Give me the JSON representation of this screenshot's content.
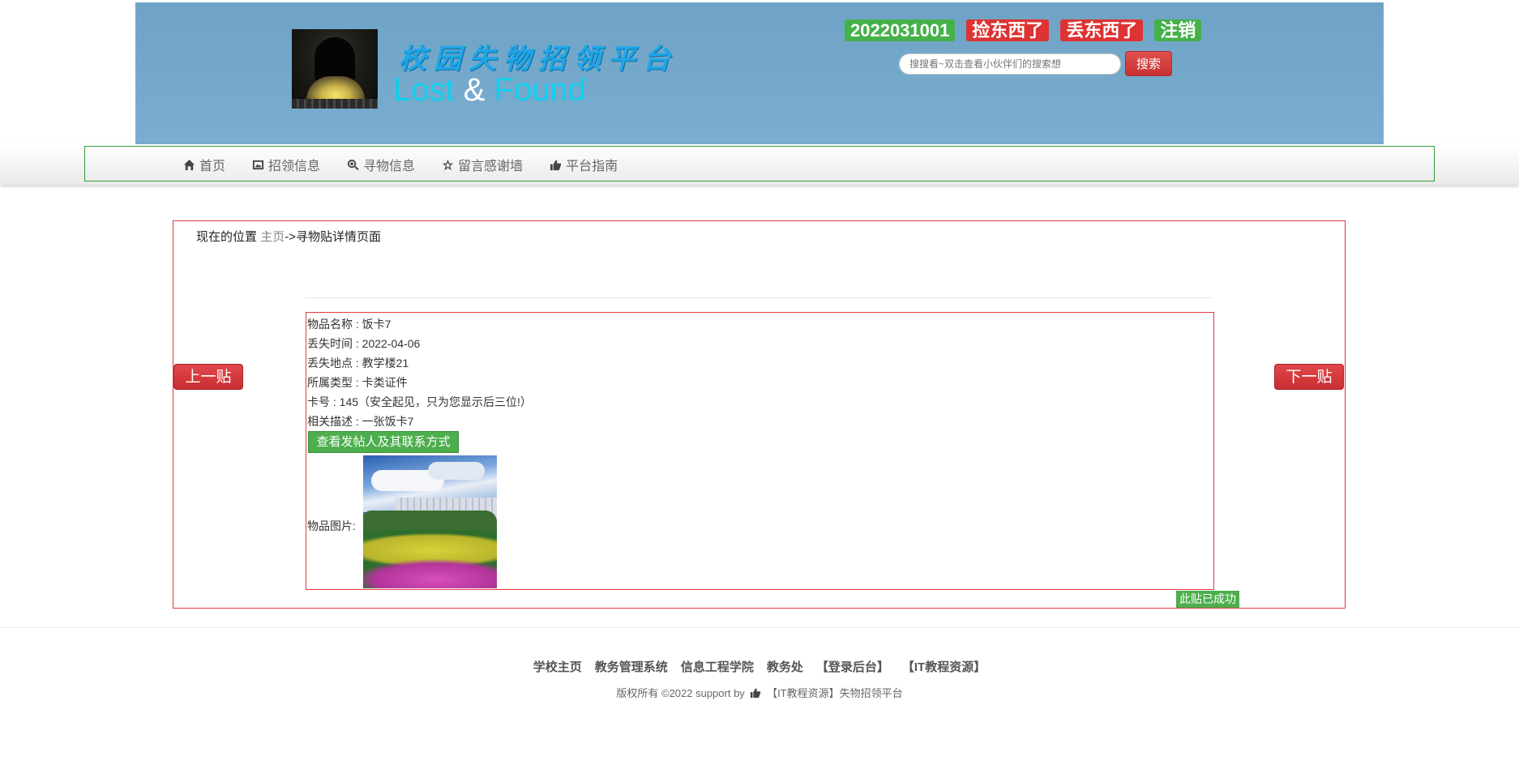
{
  "header": {
    "title_cn": "校园失物招领平台",
    "title_en_lost": "Lost",
    "title_en_amp": "&",
    "title_en_found": "Found",
    "user_id": "2022031001",
    "found_label": "捡东西了",
    "lost_label": "丢东西了",
    "logout_label": "注销",
    "search_placeholder": "搜搜看~双击查看小伙伴们的搜索想",
    "search_button": "搜索",
    "colors": {
      "header_bg": "#74a9cc",
      "green": "#45b149",
      "red": "#dd3333"
    }
  },
  "nav": {
    "items": [
      {
        "label": "首页",
        "icon": "home-icon"
      },
      {
        "label": "招领信息",
        "icon": "picture-icon"
      },
      {
        "label": "寻物信息",
        "icon": "zoom-icon"
      },
      {
        "label": "留言感谢墙",
        "icon": "star-icon"
      },
      {
        "label": "平台指南",
        "icon": "thumbs-up-icon"
      }
    ]
  },
  "breadcrumb": {
    "prefix": "现在的位置",
    "home": "主页",
    "arrow": "->",
    "current": "寻物贴详情页面"
  },
  "post": {
    "prev_label": "上一贴",
    "next_label": "下一贴",
    "fields": [
      "物品名称 : 饭卡7",
      "丢失时间 : 2022-04-06",
      "丢失地点 : 教学楼21",
      "所属类型 : 卡类证件",
      "卡号 : 145（安全起见，只为您显示后三位!）",
      "相关描述 : 一张饭卡7"
    ],
    "contact_button": "查看发帖人及其联系方式",
    "photo_label": "物品图片:",
    "status_badge": "此贴已成功"
  },
  "footer": {
    "links": [
      "学校主页",
      "教务管理系统",
      "信息工程学院",
      "教务处",
      "【登录后台】",
      "【IT教程资源】"
    ],
    "copyright_prefix": "版权所有 ©2022 support by",
    "copyright_suffix": "【IT教程资源】失物招领平台"
  }
}
